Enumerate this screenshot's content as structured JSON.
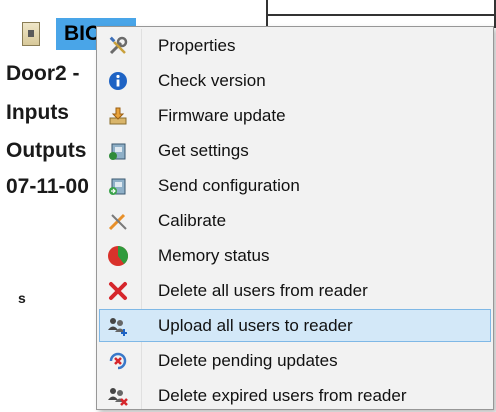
{
  "background": {
    "selected_device": "BIO",
    "rows": [
      "Door2 -",
      "Inputs",
      "Outputs",
      "07-11-00",
      "s"
    ]
  },
  "context_menu": {
    "items": [
      {
        "label": "Properties",
        "icon": "wrench-screwdriver-icon"
      },
      {
        "label": "Check version",
        "icon": "info-icon"
      },
      {
        "label": "Firmware update",
        "icon": "firmware-update-icon"
      },
      {
        "label": "Get settings",
        "icon": "get-settings-icon"
      },
      {
        "label": "Send configuration",
        "icon": "send-configuration-icon"
      },
      {
        "label": "Calibrate",
        "icon": "calibrate-icon"
      },
      {
        "label": "Memory status",
        "icon": "pie-chart-icon"
      },
      {
        "label": "Delete all users from reader",
        "icon": "red-x-icon"
      },
      {
        "label": "Upload all users to reader",
        "icon": "users-upload-icon"
      },
      {
        "label": "Delete pending updates",
        "icon": "delete-pending-icon"
      },
      {
        "label": "Delete expired users from reader",
        "icon": "users-delete-icon"
      }
    ],
    "highlighted_item": "Upload all users to reader"
  },
  "colors": {
    "selection_blue": "#49a5e8",
    "menu_background": "#f2f2f2",
    "highlight_background": "#d3e8f8",
    "highlight_border": "#7fb8e6"
  }
}
